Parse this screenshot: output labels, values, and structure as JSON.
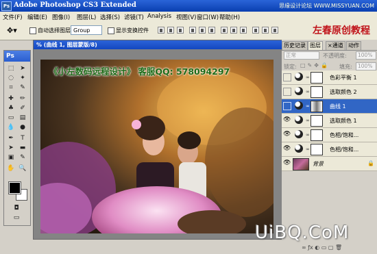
{
  "titlebar": {
    "icon": "Ps",
    "title": "Adobe Photoshop CS3 Extended",
    "watermark": "思缘设计论坛 WWW.MISSYUAN.COM"
  },
  "menu": [
    "文件(F)",
    "编辑(E)",
    "图像(I)",
    "图层(L)",
    "选择(S)",
    "滤镜(T)",
    "Analysis",
    "视图(V)",
    "窗口(W)",
    "帮助(H)"
  ],
  "options": {
    "auto_select_label": "自动选择图层",
    "group_value": "Group",
    "show_transform_label": "显示变换控件",
    "brand": "左春原创教程"
  },
  "toolbox": {
    "title": "Ps"
  },
  "document": {
    "title": "% (曲线 1, 图层蒙版/8)",
    "banner": "《小左数码远程设计》 客服QQ: 578094297"
  },
  "panels": {
    "tabs": [
      "历史记录",
      "图层",
      "×通道",
      "动作"
    ],
    "blend_mode": "正常",
    "opacity_label": "不透明度:",
    "opacity_value": "100%",
    "lock_label": "锁定:",
    "fill_label": "填充:",
    "fill_value": "100%",
    "layers": [
      {
        "name": "色彩平衡 1",
        "visible": false,
        "selected": false,
        "type": "adj"
      },
      {
        "name": "选取颜色 2",
        "visible": false,
        "selected": false,
        "type": "adj"
      },
      {
        "name": "曲线 1",
        "visible": false,
        "selected": true,
        "type": "adj"
      },
      {
        "name": "选取颜色 1",
        "visible": true,
        "selected": false,
        "type": "adj"
      },
      {
        "name": "色相/饱和...",
        "visible": true,
        "selected": false,
        "type": "adj"
      },
      {
        "name": "色相/饱和...",
        "visible": true,
        "selected": false,
        "type": "adj"
      },
      {
        "name": "背景",
        "visible": true,
        "selected": false,
        "type": "image"
      }
    ]
  },
  "watermark_bottom": "UiBQ.CoM"
}
